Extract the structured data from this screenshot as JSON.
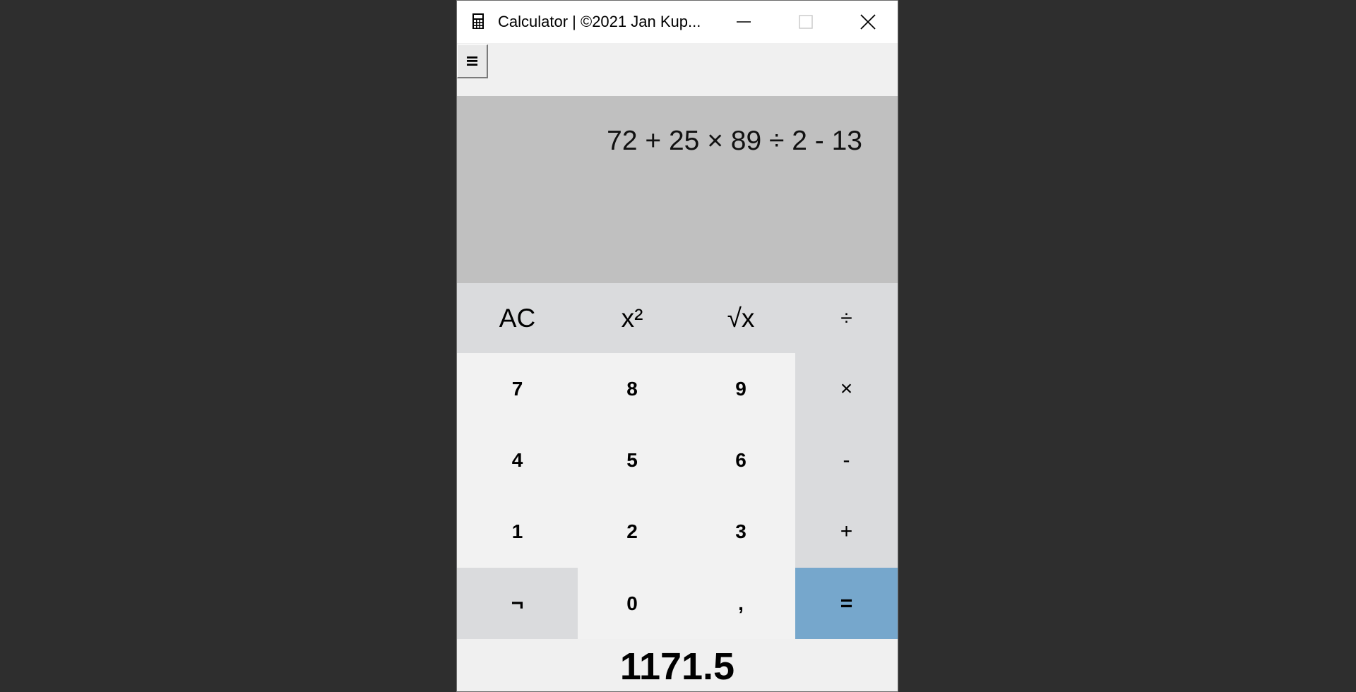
{
  "window": {
    "title": "Calculator | ©2021 Jan Kup...",
    "icon": "calculator-icon",
    "controls": [
      "minimize-icon",
      "maximize-icon",
      "close-icon"
    ]
  },
  "toolbar": {
    "menu_label": "≡"
  },
  "display": {
    "expression": "72 + 25 × 89 ÷ 2 - 13",
    "result": "1171.5"
  },
  "keys": {
    "ac": "AC",
    "square": "x²",
    "sqrt": "√x",
    "divide": "÷",
    "seven": "7",
    "eight": "8",
    "nine": "9",
    "multiply": "×",
    "four": "4",
    "five": "5",
    "six": "6",
    "minus": "-",
    "one": "1",
    "two": "2",
    "three": "3",
    "plus": "+",
    "negate": "¬",
    "zero": "0",
    "comma": ",",
    "equals": "="
  },
  "colors": {
    "display_bg": "#c0c0c0",
    "function_key_bg": "#dadbdd",
    "digit_key_bg": "#f2f2f2",
    "equals_key_bg": "#76a7cc",
    "background": "#2e2e2e"
  }
}
